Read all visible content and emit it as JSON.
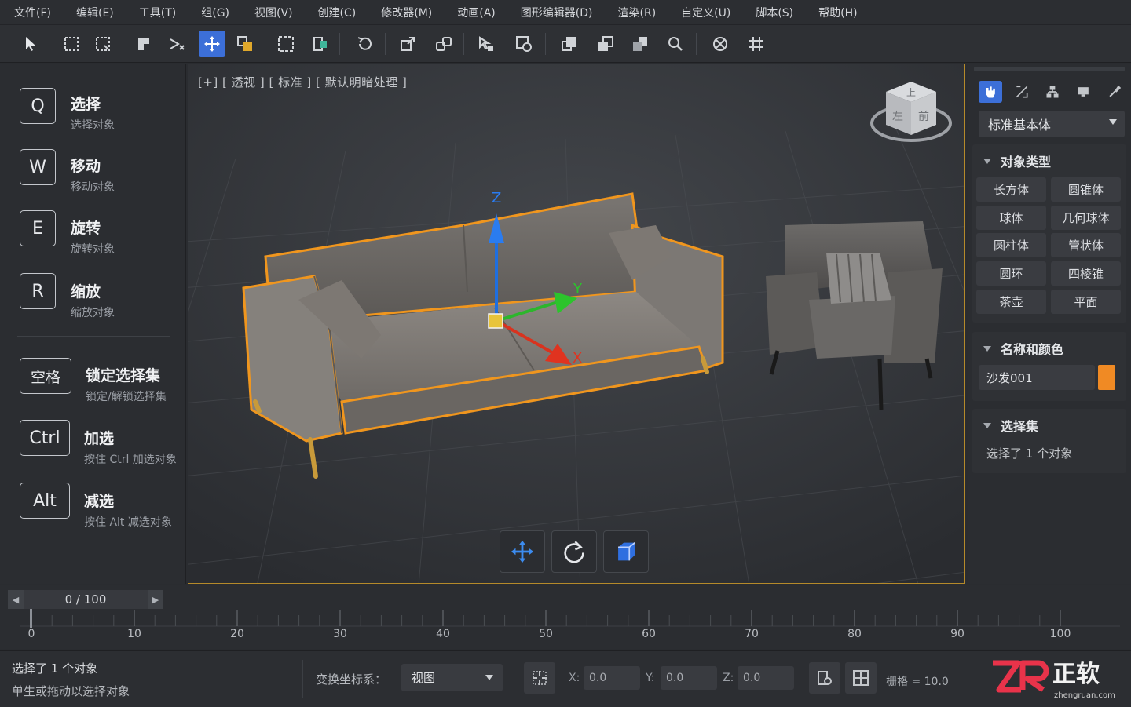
{
  "menu": [
    "文件(F)",
    "编辑(E)",
    "工具(T)",
    "组(G)",
    "视图(V)",
    "创建(C)",
    "修改器(M)",
    "动画(A)",
    "图形编辑器(D)",
    "渲染(R)",
    "自定义(U)",
    "脚本(S)",
    "帮助(H)"
  ],
  "shortcuts": [
    {
      "key": "Q",
      "title": "选择",
      "desc": "选择对象"
    },
    {
      "key": "W",
      "title": "移动",
      "desc": "移动对象"
    },
    {
      "key": "E",
      "title": "旋转",
      "desc": "旋转对象"
    },
    {
      "key": "R",
      "title": "缩放",
      "desc": "缩放对象"
    },
    {
      "key": "空格",
      "title": "锁定选择集",
      "desc": "锁定/解锁选择集"
    },
    {
      "key": "Ctrl",
      "title": "加选",
      "desc": "按住 Ctrl 加选对象"
    },
    {
      "key": "Alt",
      "title": "减选",
      "desc": "按住 Alt 减选对象"
    }
  ],
  "viewport": {
    "label": "[+] [ 透视 ] [ 标准 ] [ 默认明暗处理 ]",
    "viewcube": {
      "top": "上",
      "left": "左",
      "front": "前"
    },
    "axes": {
      "x": "X",
      "y": "Y",
      "z": "Z"
    }
  },
  "right_panel": {
    "dropdown": "标准基本体",
    "object_type_title": "对象类型",
    "object_types": [
      "长方体",
      "圆锥体",
      "球体",
      "几何球体",
      "圆柱体",
      "管状体",
      "圆环",
      "四棱锥",
      "茶壶",
      "平面"
    ],
    "name_color_title": "名称和颜色",
    "object_name": "沙发001",
    "object_color": "#f08a24",
    "selection_title": "选择集",
    "selection_text": "选择了  1  个对象"
  },
  "timeline": {
    "frame_display": "0 / 100",
    "current_frame": 0,
    "total_frames": 100,
    "tick_labels": [
      "0",
      "10",
      "20",
      "30",
      "40",
      "50",
      "60",
      "70",
      "80",
      "90",
      "100"
    ]
  },
  "status": {
    "line1": "选择了  1  个对象",
    "line2": "单生或拖动以选择对象",
    "coord_label": "变换坐标系：",
    "coord_value": "视图",
    "x_label": "X:",
    "x_value": "0.0",
    "y_label": "Y:",
    "y_value": "0.0",
    "z_label": "Z:",
    "z_value": "0.0",
    "grid_label": "栅格 = 10.0"
  },
  "logo": {
    "text": "正软",
    "url": "zhengruan.com"
  },
  "colors": {
    "accent": "#3c6fd8",
    "selection": "#f0961e",
    "viewport_border": "#b58a2a"
  }
}
